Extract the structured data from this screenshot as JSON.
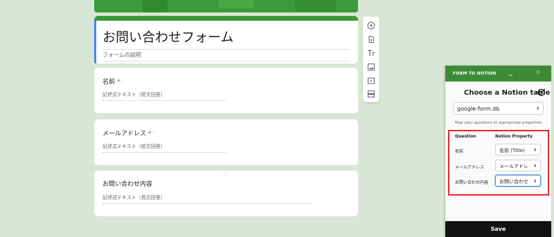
{
  "form": {
    "title": "お問い合わせフォーム",
    "description": "フォームの説明",
    "questions": [
      {
        "label": "名前",
        "required": "*",
        "answer_placeholder": "記述式テキスト（短文回答）"
      },
      {
        "label": "メールアドレス",
        "required": "*",
        "answer_placeholder": "記述式テキスト（短文回答）"
      },
      {
        "label": "お問い合わせ内容",
        "required": "",
        "answer_placeholder": "記述式テキスト（長文回答）"
      }
    ],
    "drag_handle": ":::"
  },
  "toolbar": {
    "icons": [
      "add-question-icon",
      "import-questions-icon",
      "add-title-icon",
      "add-image-icon",
      "add-video-icon",
      "add-section-icon"
    ]
  },
  "panel": {
    "title": "FORM TO NOTION",
    "minimize_label": "_",
    "close_label": "✕",
    "heading": "Choose a Notion table",
    "database": "google-form.db",
    "map_note": "Map your questions to appropriate properties",
    "col_question": "Question",
    "col_property": "Notion Property",
    "rows": [
      {
        "question": "名前",
        "property": "名前 (Title)"
      },
      {
        "question": "メールアドレス",
        "property": "メールアドレ"
      },
      {
        "question": "お問い合わせ内容",
        "property": "お問い合わせ"
      }
    ],
    "save_label": "Save"
  },
  "colors": {
    "brand_green": "#3d8b37",
    "highlight_red": "#e8232a",
    "page_bg": "#d8e6d5"
  }
}
